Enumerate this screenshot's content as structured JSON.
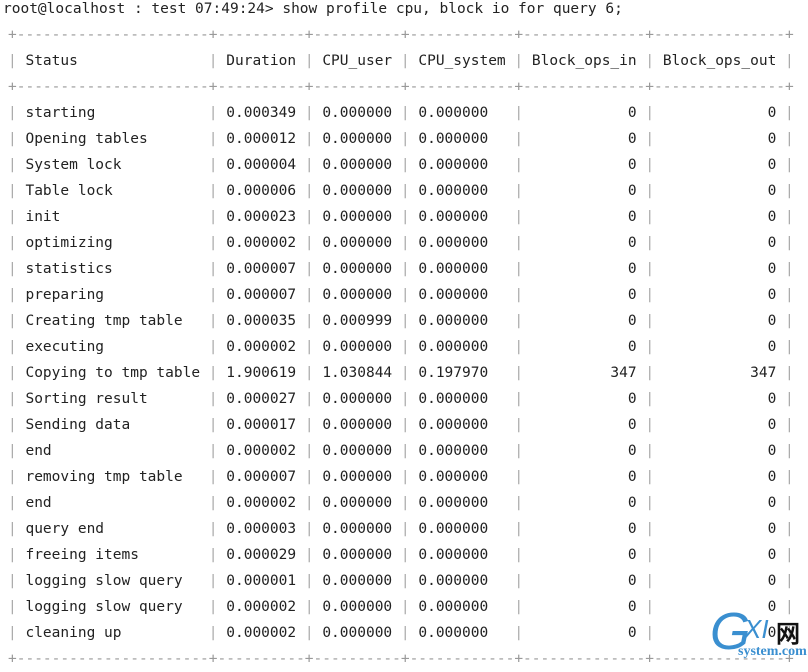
{
  "prompt": "root@localhost : test 07:49:24> show profile cpu, block io for query 6;",
  "columns": [
    "Status",
    "Duration",
    "CPU_user",
    "CPU_system",
    "Block_ops_in",
    "Block_ops_out"
  ],
  "rows": [
    [
      "starting",
      "0.000349",
      "0.000000",
      "0.000000",
      "0",
      "0"
    ],
    [
      "Opening tables",
      "0.000012",
      "0.000000",
      "0.000000",
      "0",
      "0"
    ],
    [
      "System lock",
      "0.000004",
      "0.000000",
      "0.000000",
      "0",
      "0"
    ],
    [
      "Table lock",
      "0.000006",
      "0.000000",
      "0.000000",
      "0",
      "0"
    ],
    [
      "init",
      "0.000023",
      "0.000000",
      "0.000000",
      "0",
      "0"
    ],
    [
      "optimizing",
      "0.000002",
      "0.000000",
      "0.000000",
      "0",
      "0"
    ],
    [
      "statistics",
      "0.000007",
      "0.000000",
      "0.000000",
      "0",
      "0"
    ],
    [
      "preparing",
      "0.000007",
      "0.000000",
      "0.000000",
      "0",
      "0"
    ],
    [
      "Creating tmp table",
      "0.000035",
      "0.000999",
      "0.000000",
      "0",
      "0"
    ],
    [
      "executing",
      "0.000002",
      "0.000000",
      "0.000000",
      "0",
      "0"
    ],
    [
      "Copying to tmp table",
      "1.900619",
      "1.030844",
      "0.197970",
      "347",
      "347"
    ],
    [
      "Sorting result",
      "0.000027",
      "0.000000",
      "0.000000",
      "0",
      "0"
    ],
    [
      "Sending data",
      "0.000017",
      "0.000000",
      "0.000000",
      "0",
      "0"
    ],
    [
      "end",
      "0.000002",
      "0.000000",
      "0.000000",
      "0",
      "0"
    ],
    [
      "removing tmp table",
      "0.000007",
      "0.000000",
      "0.000000",
      "0",
      "0"
    ],
    [
      "end",
      "0.000002",
      "0.000000",
      "0.000000",
      "0",
      "0"
    ],
    [
      "query end",
      "0.000003",
      "0.000000",
      "0.000000",
      "0",
      "0"
    ],
    [
      "freeing items",
      "0.000029",
      "0.000000",
      "0.000000",
      "0",
      "0"
    ],
    [
      "logging slow query",
      "0.000001",
      "0.000000",
      "0.000000",
      "0",
      "0"
    ],
    [
      "logging slow query",
      "0.000002",
      "0.000000",
      "0.000000",
      "0",
      "0"
    ],
    [
      "cleaning up",
      "0.000002",
      "0.000000",
      "0.000000",
      "0",
      "0"
    ]
  ],
  "watermark": {
    "logo": "GXI网",
    "domain": "system.com"
  },
  "colors": {
    "text": "#222222",
    "border": "#999999",
    "watermark": "#3a8fd0"
  }
}
